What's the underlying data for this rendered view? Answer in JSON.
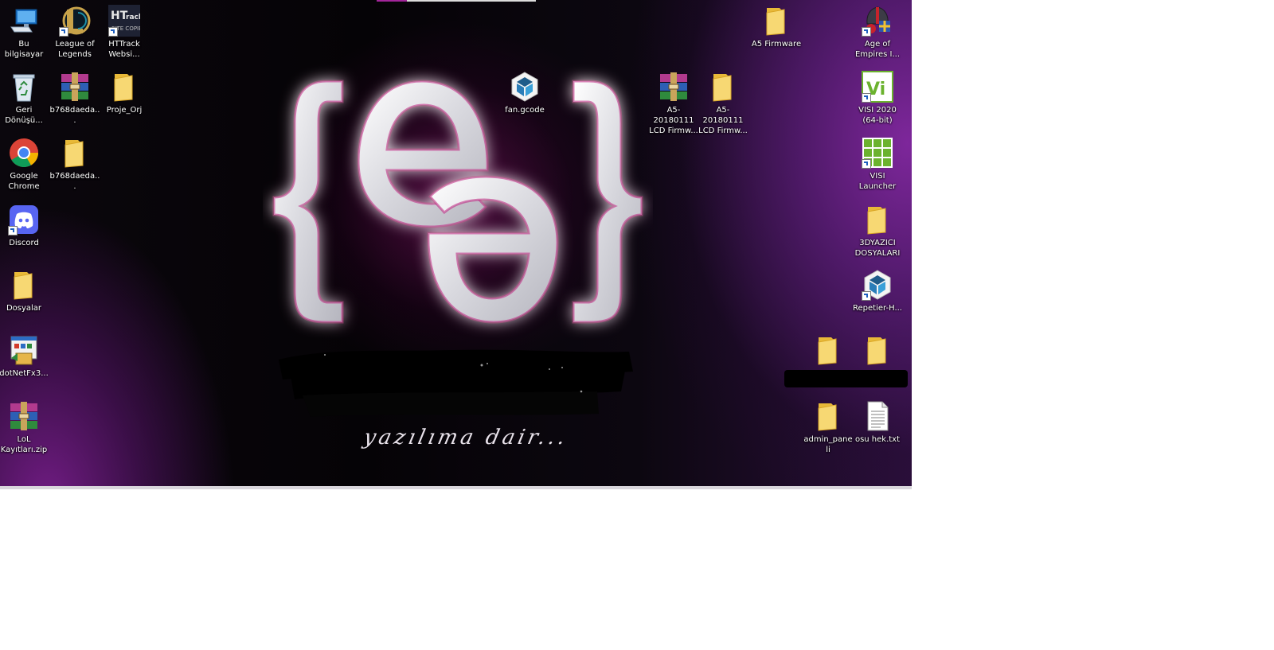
{
  "desktop": {
    "wallpaper": {
      "tagline": "yazılıma dair...",
      "accent_color": "#a3259a"
    },
    "icons": [
      {
        "label": "Bu bilgisayar",
        "icon": "this-pc-icon"
      },
      {
        "label": "League of Legends",
        "icon": "league-of-legends-icon"
      },
      {
        "label": "HTTrack Websi...",
        "icon": "httrack-icon"
      },
      {
        "label": "Geri Dönüşü...",
        "icon": "recycle-bin-icon"
      },
      {
        "label": "b768daeda...",
        "icon": "winrar-archive-icon"
      },
      {
        "label": "Proje_Orj",
        "icon": "folder-icon"
      },
      {
        "label": "Google Chrome",
        "icon": "chrome-icon"
      },
      {
        "label": "b768daeda...",
        "icon": "folder-icon"
      },
      {
        "label": "Discord",
        "icon": "discord-icon"
      },
      {
        "label": "Dosyalar",
        "icon": "folder-icon"
      },
      {
        "label": "dotNetFx3...",
        "icon": "installer-icon"
      },
      {
        "label": "LoL Kayıtları.zip",
        "icon": "winrar-archive-icon"
      },
      {
        "label": "fan.gcode",
        "icon": "repetier-icon"
      },
      {
        "label": "A5-20180111 LCD Firmw...",
        "icon": "winrar-archive-icon"
      },
      {
        "label": "A5-20180111 LCD Firmw...",
        "icon": "folder-icon"
      },
      {
        "label": "A5 Firmware",
        "icon": "folder-icon"
      },
      {
        "label": "Age of Empires I...",
        "icon": "age-of-empires-icon"
      },
      {
        "label": "VISI 2020 (64-bit)",
        "icon": "visi-icon"
      },
      {
        "label": "VISI Launcher",
        "icon": "visi-launcher-icon"
      },
      {
        "label": "3DYAZICI DOSYALARI",
        "icon": "folder-icon"
      },
      {
        "label": "Repetier-H...",
        "icon": "repetier-icon"
      },
      {
        "label": "admin_paneli",
        "icon": "folder-icon"
      },
      {
        "label": "osu hek.txt",
        "icon": "text-file-icon"
      }
    ]
  }
}
